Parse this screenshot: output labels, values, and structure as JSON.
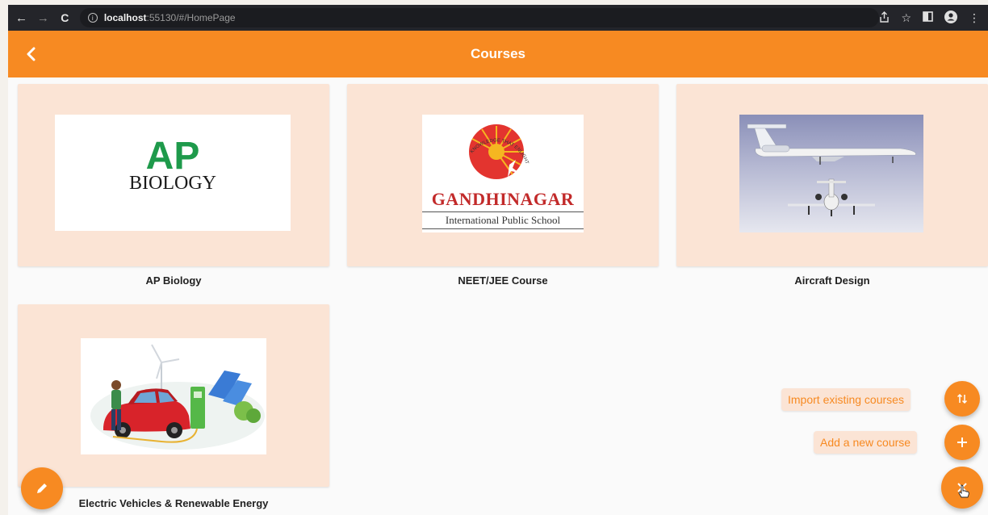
{
  "browser": {
    "url_host": "localhost",
    "url_rest": ":55130/#/HomePage"
  },
  "app_bar": {
    "title": "Courses"
  },
  "courses": [
    {
      "name": "AP Biology",
      "image": {
        "line1": "AP",
        "line2": "BIOLOGY"
      }
    },
    {
      "name": "NEET/JEE Course",
      "image": {
        "arc_text": "KNOWLEDGE THAT ENLIGHTENS",
        "school": "GANDHINAGAR",
        "subtitle": "International Public School"
      }
    },
    {
      "name": "Aircraft Design",
      "image": {}
    },
    {
      "name": "Electric Vehicles & Renewable Energy",
      "image": {}
    }
  ],
  "fab_menu": {
    "import_label": "Import existing courses",
    "add_label": "Add a new course"
  },
  "colors": {
    "accent": "#f78a22",
    "card_bg": "#fbe4d5",
    "browser_bar": "#24252a"
  },
  "icons": [
    "back-arrow-icon",
    "forward-arrow-icon",
    "reload-icon",
    "info-icon",
    "share-icon",
    "star-icon",
    "sidebar-icon",
    "profile-icon",
    "more-icon",
    "chevron-left-icon",
    "import-sort-icon",
    "plus-icon",
    "close-icon",
    "pencil-icon",
    "cursor-hand-icon"
  ]
}
